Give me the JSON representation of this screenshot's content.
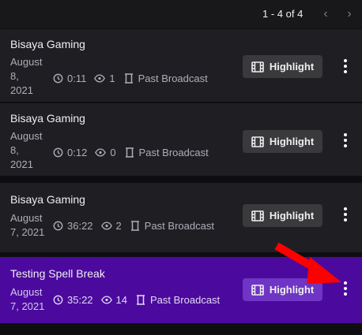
{
  "pagination": {
    "range": "1 - 4 of 4",
    "prev_icon": "‹",
    "next_icon": "›"
  },
  "videos": [
    {
      "title": "Bisaya Gaming",
      "date_line1": "August",
      "date_line2": "8,",
      "date_line3": "2021",
      "duration": "0:11",
      "views": "1",
      "type": "Past Broadcast",
      "button": "Highlight"
    },
    {
      "title": "Bisaya Gaming",
      "date_line1": "August",
      "date_line2": "8,",
      "date_line3": "2021",
      "duration": "0:12",
      "views": "0",
      "type": "Past Broadcast",
      "button": "Highlight"
    },
    {
      "title": "Bisaya Gaming",
      "date_line1": "August",
      "date_line2": "7, 2021",
      "date_line3": "",
      "duration": "36:22",
      "views": "2",
      "type": "Past Broadcast",
      "button": "Highlight"
    },
    {
      "title": "Testing Spell Break",
      "date_line1": "August",
      "date_line2": "7, 2021",
      "date_line3": "",
      "duration": "35:22",
      "views": "14",
      "type": "Past Broadcast",
      "button": "Highlight",
      "selected": true
    }
  ],
  "colors": {
    "background": "#0e0e10",
    "card": "#1f1f23",
    "selected_card": "#4b0a9d",
    "arrow": "#ff0000"
  },
  "icons": {
    "duration": "clock-icon",
    "views": "eye-icon",
    "type": "broadcast-icon",
    "button": "film-icon",
    "menu": "more-vertical-icon",
    "annotation": "red-arrow-icon"
  }
}
